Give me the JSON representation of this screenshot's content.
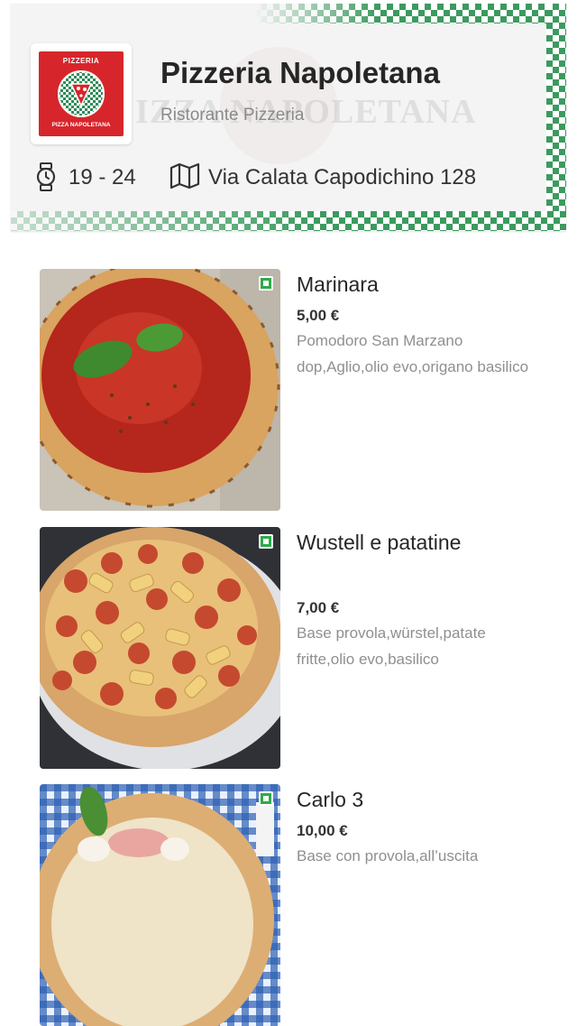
{
  "restaurant": {
    "name": "Pizzeria Napoletana",
    "category": "Ristorante Pizzeria",
    "hours": "19 - 24",
    "address": "Via Calata Capodichino 128",
    "watermark": "IZZA NAPOLETANA",
    "logo": {
      "top_text": "PIZZERIA",
      "bottom_text": "PIZZA NAPOLETANA"
    }
  },
  "icons": {
    "hours": "watch-icon",
    "address": "map-icon",
    "veg": "vegetarian-badge-icon"
  },
  "colors": {
    "accent_green": "#3c9a5f",
    "logo_red": "#d7262b",
    "veg_green": "#2faa4a"
  },
  "menu": [
    {
      "name": "Marinara",
      "price": "5,00 €",
      "description": "Pomodoro San Marzano dop,Aglio,olio evo,origano basilico"
    },
    {
      "name": "Wustell e patatine",
      "price": "7,00 €",
      "description": "Base provola,würstel,patate fritte,olio evo,basilico"
    },
    {
      "name": "Carlo 3",
      "price": "10,00 €",
      "description": "Base con provola,all’uscita"
    }
  ]
}
